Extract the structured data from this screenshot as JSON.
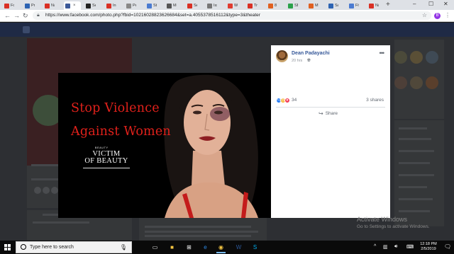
{
  "browser": {
    "tabs": [
      {
        "label": "Fon",
        "color": "#d93025"
      },
      {
        "label": "Pre",
        "color": "#2d64b3"
      },
      {
        "label": "Na",
        "color": "#d93025"
      },
      {
        "label": "",
        "color": "#3b5998",
        "active": true
      },
      {
        "label": "Sey",
        "color": "#222222"
      },
      {
        "label": "Inb",
        "color": "#d93025"
      },
      {
        "label": "Pen",
        "color": "#888888"
      },
      {
        "label": "Stru",
        "color": "#4b7bd1"
      },
      {
        "label": "Me",
        "color": "#555555"
      },
      {
        "label": "Sey",
        "color": "#d93025"
      },
      {
        "label": "Issu",
        "color": "#777777"
      },
      {
        "label": "WC",
        "color": "#e03c31"
      },
      {
        "label": "Tra",
        "color": "#d93025"
      },
      {
        "label": "8 p",
        "color": "#e06020"
      },
      {
        "label": "SBC",
        "color": "#2aa14b"
      },
      {
        "label": "MH",
        "color": "#e06020"
      },
      {
        "label": "Say",
        "color": "#2d64b3"
      },
      {
        "label": "Five",
        "color": "#4b7bd1"
      },
      {
        "label": "Nar",
        "color": "#d93025"
      }
    ],
    "close_glyph": "×",
    "new_tab_glyph": "+",
    "url": "https://www.facebook.com/photo.php?fbid=10216028823626684&set=a.4055378516112&type=3&theater",
    "profile_initial": "B",
    "window_controls": [
      "–",
      "☐",
      "✕"
    ]
  },
  "post": {
    "author": "Dean Padayachi",
    "time": "20 hrs",
    "reaction_count": "34",
    "shares": "3 shares",
    "share_label": "Share",
    "more_glyph": "•••"
  },
  "photo": {
    "line1": "Stop Violence",
    "line2": "Against Women",
    "beauty": "BEAUTY",
    "victim1": "VICTIM",
    "victim2": "OF BEAUTY"
  },
  "watermark": {
    "title": "Activate Windows",
    "subtitle": "Go to Settings to activate Windows."
  },
  "taskbar": {
    "search_placeholder": "Type here to search",
    "time": "12:18 PM",
    "date": "2/5/2019"
  }
}
